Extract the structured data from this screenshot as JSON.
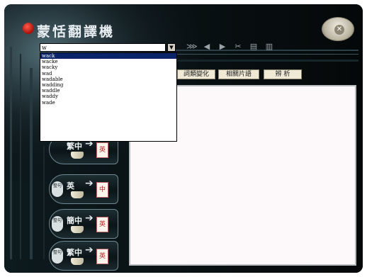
{
  "app": {
    "title": "蒙恬翻譯機",
    "close_icon": "close-dial-icon",
    "accent_color": "#0a246a"
  },
  "search": {
    "value": "w",
    "dropdown_icon": "▼"
  },
  "suggestions": {
    "items": [
      "wack",
      "wacke",
      "wacky",
      "wad",
      "wadable",
      "wadding",
      "waddle",
      "waddy",
      "wade"
    ],
    "selected_index": 0
  },
  "toolbar": {
    "icons": [
      "translate-icon",
      "back-arrow-icon",
      "forward-arrow-icon",
      "cut-icon",
      "copy-icon",
      "paste-icon"
    ]
  },
  "tabs": {
    "items": [
      "詞類變化",
      "相關片語",
      "辨 析"
    ]
  },
  "modes": {
    "items": [
      {
        "tag": "",
        "source": "繁中",
        "target": "英"
      },
      {
        "tag": "整句",
        "source": "英",
        "target": "中"
      },
      {
        "tag": "整句",
        "source": "簡中",
        "target": "英"
      },
      {
        "tag": "整句",
        "source": "繁中",
        "target": "英"
      }
    ]
  }
}
